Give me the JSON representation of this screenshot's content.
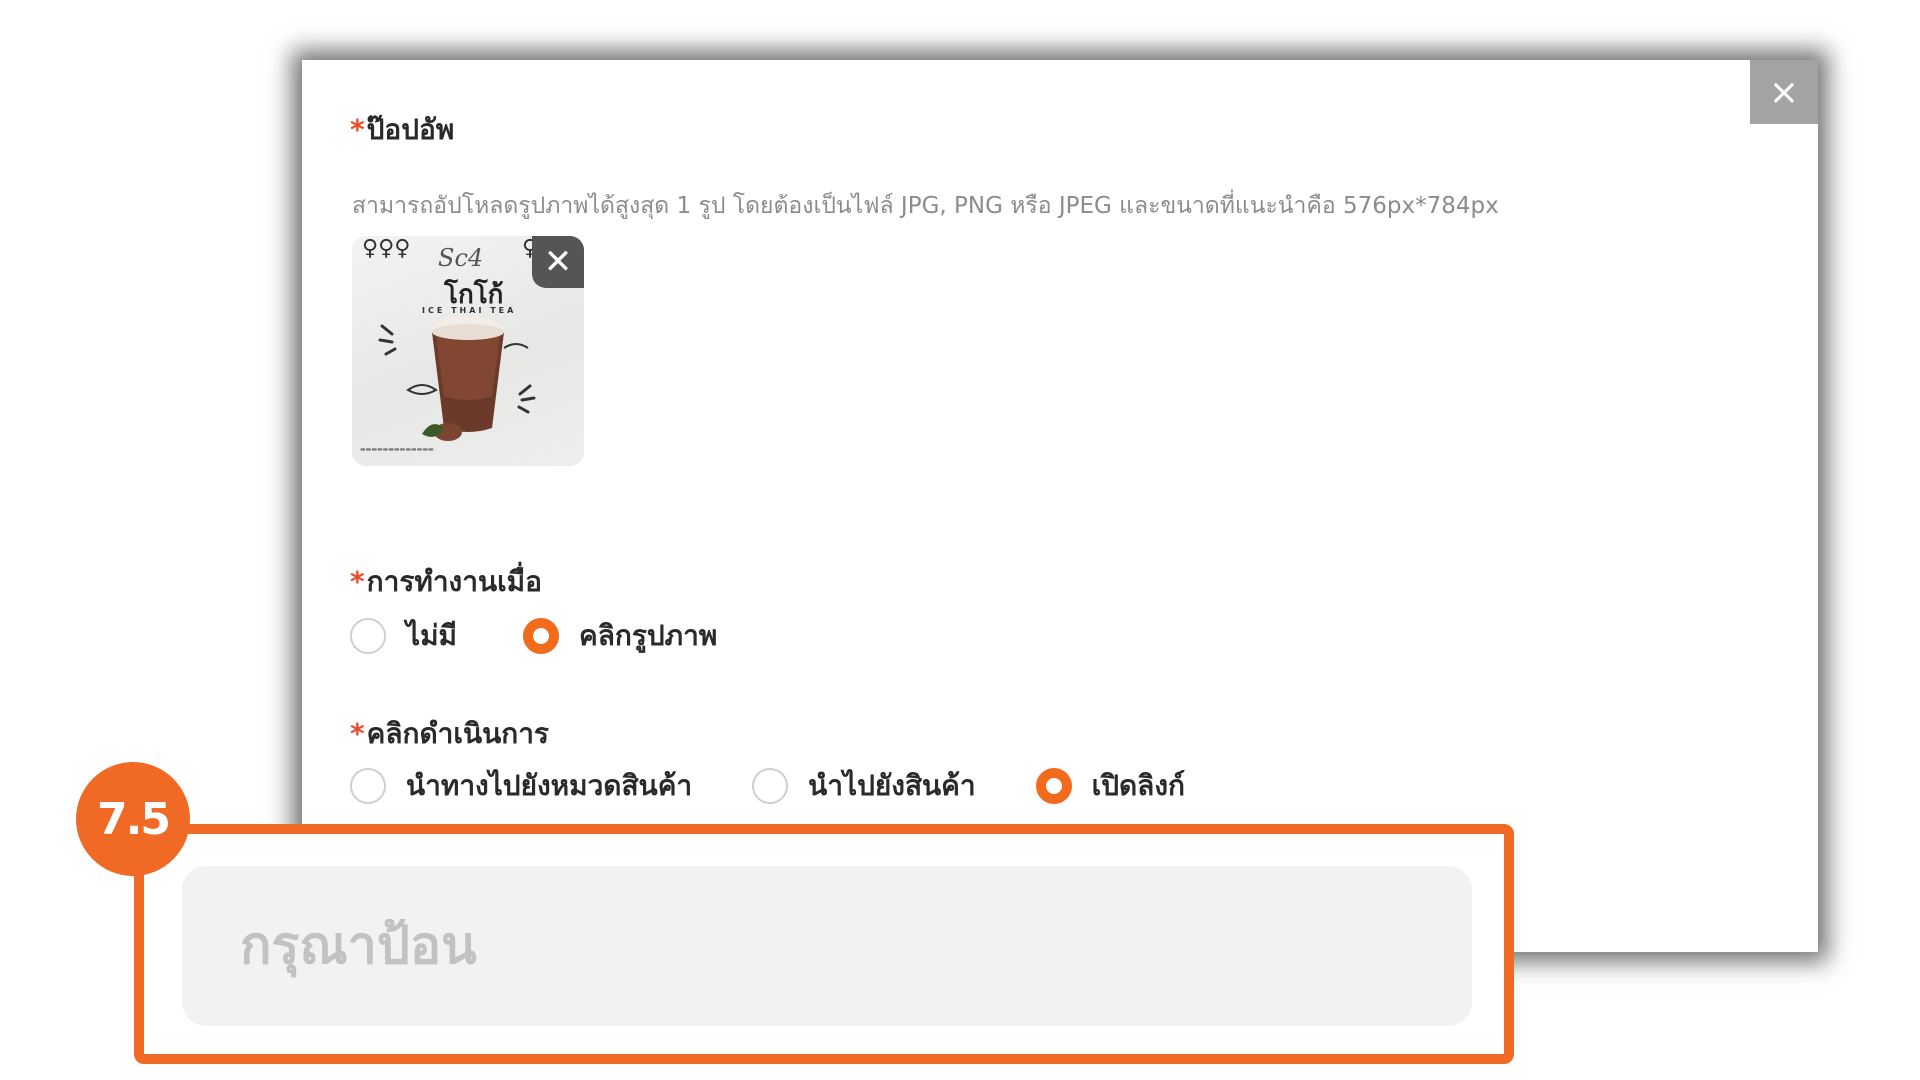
{
  "modal": {
    "close_icon": "×",
    "popup": {
      "required_mark": "*",
      "label": "ป๊อปอัพ",
      "hint": "สามารถอัปโหลดรูปภาพได้สูงสุด 1 รูป โดยต้องเป็นไฟล์ JPG, PNG หรือ JPEG และขนาดที่แนะนำคือ 576px*784px",
      "thumbnail": {
        "remove_icon": "✕",
        "brand": "Sc4",
        "title": "โกโก้",
        "subtitle": "ICE THAI TEA"
      }
    },
    "trigger": {
      "required_mark": "*",
      "label": "การทำงานเมื่อ",
      "options": [
        {
          "label": "ไม่มี",
          "selected": false
        },
        {
          "label": "คลิกรูปภาพ",
          "selected": true
        }
      ]
    },
    "click_action": {
      "required_mark": "*",
      "label": "คลิกดำเนินการ",
      "options": [
        {
          "label": "นำทางไปยังหมวดสินค้า",
          "selected": false
        },
        {
          "label": "นำไปยังสินค้า",
          "selected": false
        },
        {
          "label": "เปิดลิงก์",
          "selected": true
        }
      ]
    }
  },
  "callout": {
    "step": "7.5",
    "input_placeholder": "กรุณาป้อน"
  },
  "colors": {
    "accent": "#f06a26",
    "radio_selected": "#f26a1b",
    "required": "#e94b2a",
    "close_button_bg": "#a3a3a3"
  }
}
